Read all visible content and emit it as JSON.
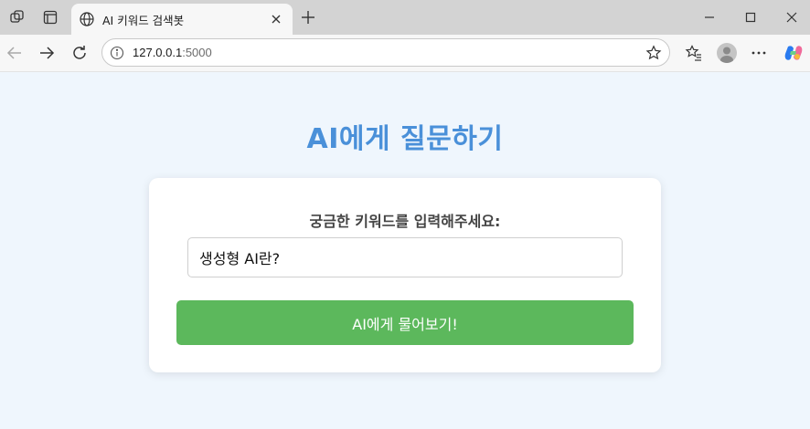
{
  "browser": {
    "tab_title": "AI 키워드 검색봇",
    "url_host": "127.0.0.1",
    "url_port": ":5000"
  },
  "page": {
    "title": "AI에게 질문하기",
    "prompt_label": "궁금한 키워드를 입력해주세요:",
    "input_value": "생성형 AI란?",
    "submit_label": "AI에게 물어보기!"
  },
  "colors": {
    "title": "#4a90d9",
    "button": "#5cb85c",
    "background": "#eff6fd"
  }
}
